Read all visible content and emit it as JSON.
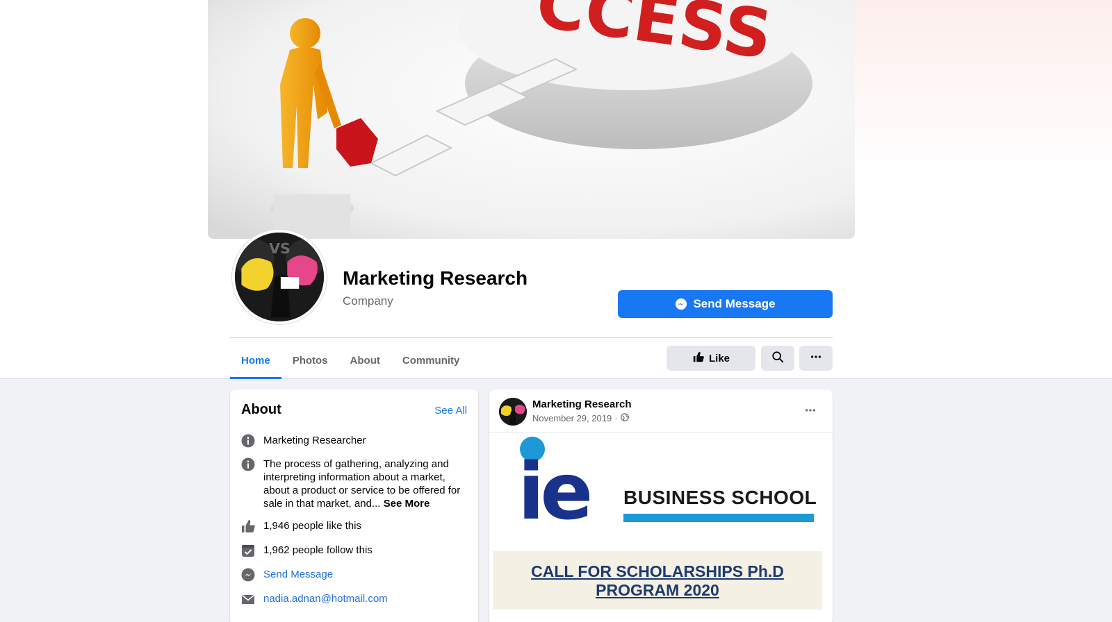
{
  "page": {
    "name": "Marketing Research",
    "category": "Company",
    "send_message_label": "Send Message"
  },
  "cover": {
    "headline_fragment": "CCESS"
  },
  "tabs": [
    {
      "label": "Home",
      "active": true
    },
    {
      "label": "Photos",
      "active": false
    },
    {
      "label": "About",
      "active": false
    },
    {
      "label": "Community",
      "active": false
    }
  ],
  "actions": {
    "like_label": "Like"
  },
  "about": {
    "title": "About",
    "see_all": "See All",
    "items": [
      {
        "icon": "info-icon",
        "text": "Marketing Researcher"
      },
      {
        "icon": "info-icon",
        "text": "The process of gathering, analyzing and interpreting information about a market, about a product or service to be offered for sale in that market, and...",
        "see_more": "See More"
      },
      {
        "icon": "thumbs-up-icon",
        "text": "1,946 people like this"
      },
      {
        "icon": "follow-check-icon",
        "text": "1,962 people follow this"
      },
      {
        "icon": "messenger-icon",
        "text": "Send Message"
      },
      {
        "icon": "email-icon",
        "text": "nadia.adnan@hotmail.com"
      }
    ]
  },
  "post": {
    "author": "Marketing Research",
    "date": "November 29, 2019",
    "separator": "·",
    "image": {
      "logo": "ie",
      "school": "BUSINESS SCHOOL",
      "call_line1": "CALL FOR SCHOLARSHIPS Ph.D",
      "call_line2": "PROGRAM 2020"
    }
  },
  "colors": {
    "accent": "#1877f2",
    "ie_blue": "#19328c",
    "ie_light_blue": "#1d9ad6",
    "cover_red": "#d11f1f",
    "figure_orange": "#f2a20a"
  }
}
